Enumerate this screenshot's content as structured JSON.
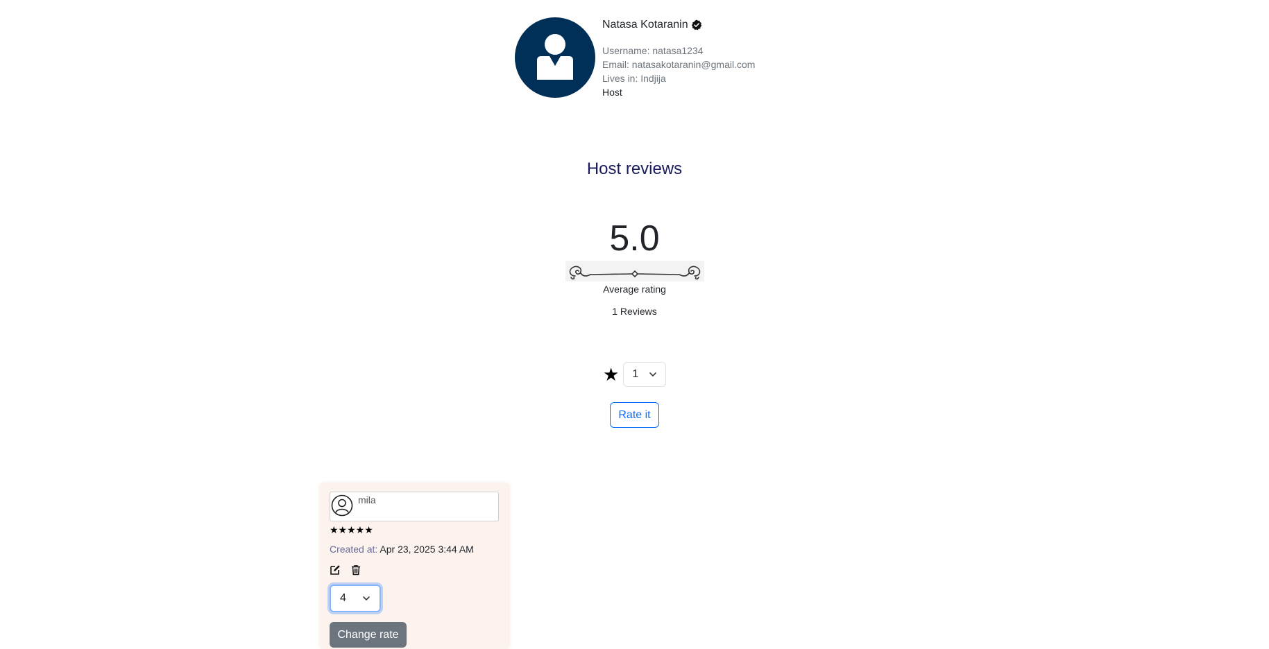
{
  "profile": {
    "name": "Natasa Kotaranin",
    "username": "Username: natasa1234",
    "email": "Email: natasakotaranin@gmail.com",
    "location": "Lives in: Indjija",
    "role": "Host",
    "avatar_icon": "user-avatar-icon",
    "verified_icon": "verified-badge-icon"
  },
  "reviews": {
    "title": "Host reviews",
    "average": "5.0",
    "average_label": "Average rating",
    "count_label": "1 Reviews",
    "rate_select_value": "1",
    "rate_button": "Rate it"
  },
  "review_list": [
    {
      "reviewer": "mila",
      "stars": "★★★★★",
      "rating": 5,
      "created_label": "Created at:",
      "created_value": "Apr 23, 2025 3:44 AM",
      "change_select_value": "4",
      "change_button": "Change rate"
    }
  ],
  "colors": {
    "avatar_bg": "#003057",
    "title": "#1a1a5e",
    "primary": "#0d6efd",
    "secondary": "#6c757d",
    "card_bg": "#fdf3ee"
  }
}
